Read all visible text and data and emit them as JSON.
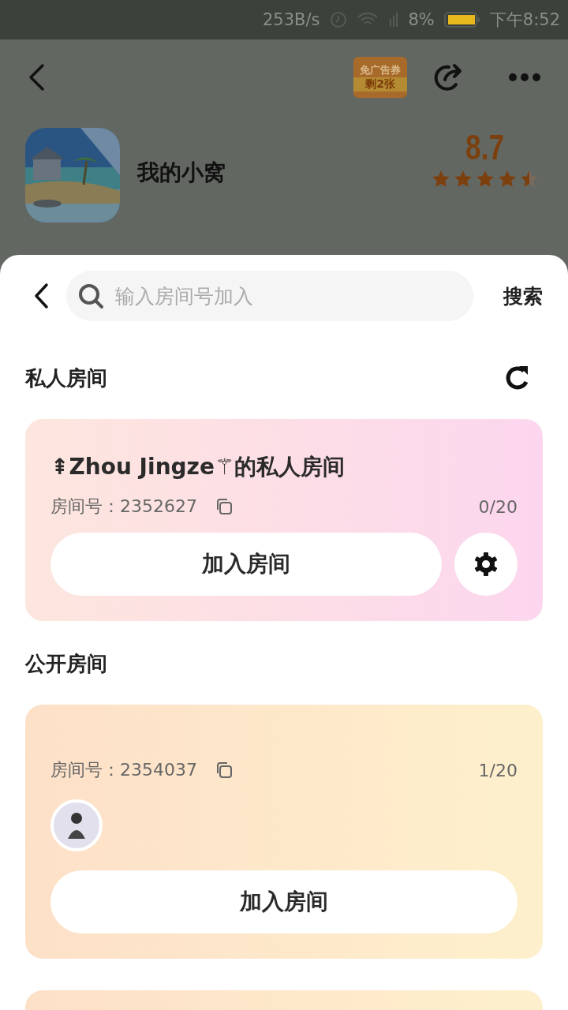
{
  "status_bar": {
    "speed": "253B/s",
    "battery_percent": "8%",
    "time": "下午8:52"
  },
  "header": {
    "ad_coupon": {
      "line_1": "免广告券",
      "line_2": "剩2张"
    }
  },
  "app": {
    "name": "我的小窝",
    "score": "8.7",
    "stars": 4.5
  },
  "search": {
    "placeholder": "输入房间号加入",
    "button": "搜索"
  },
  "private_section": {
    "title": "私人房间",
    "rooms": [
      {
        "title": "⇞Zhou Jingze⚚的私人房间",
        "room_label": "房间号：",
        "room_number": "2352627",
        "occupancy": "0/20",
        "join": "加入房间"
      }
    ]
  },
  "public_section": {
    "title": "公开房间",
    "rooms": [
      {
        "room_label": "房间号：",
        "room_number": "2354037",
        "occupancy": "1/20",
        "members": [
          {
            "kind": "avatar"
          }
        ],
        "join": "加入房间"
      }
    ]
  }
}
